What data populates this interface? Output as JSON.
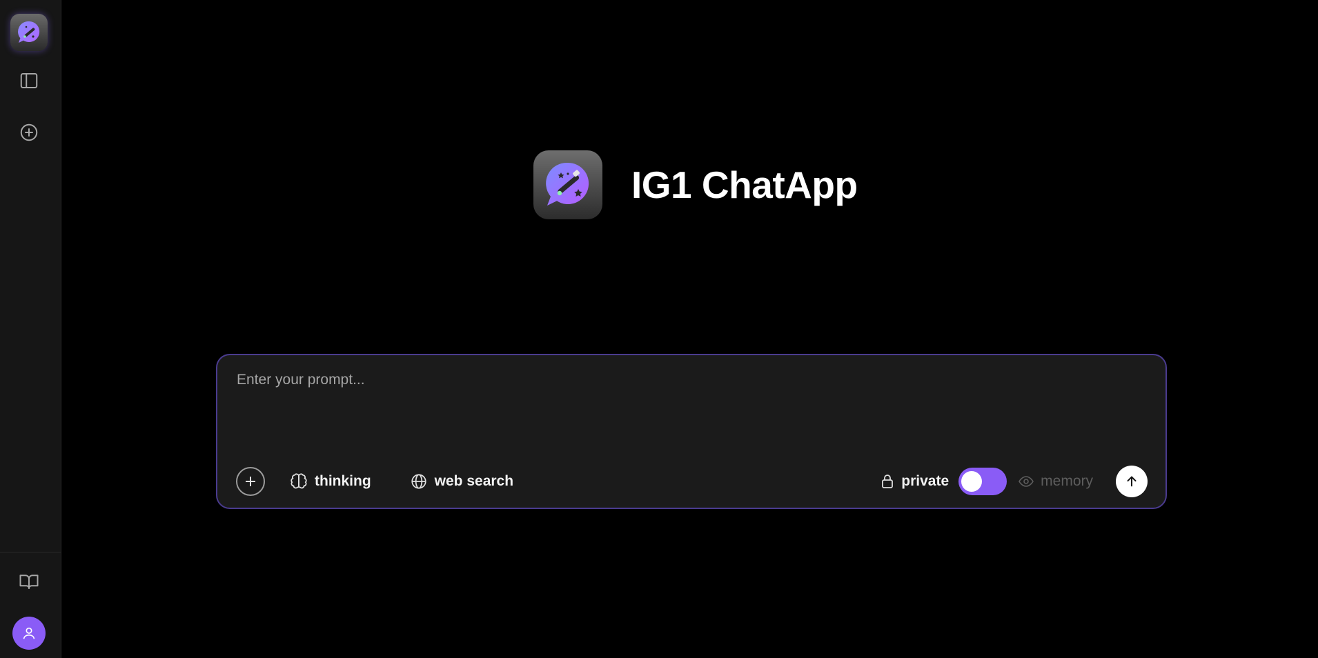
{
  "app": {
    "title": "IG1 ChatApp",
    "logo_icon": "chat-magic-wand-icon"
  },
  "sidebar": {
    "items": [
      {
        "name": "app-logo",
        "icon": "chat-magic-wand-icon"
      },
      {
        "name": "toggle-sidebar",
        "icon": "sidebar-panel-icon"
      },
      {
        "name": "new-chat",
        "icon": "plus-circle-icon"
      },
      {
        "name": "docs",
        "icon": "book-open-icon"
      },
      {
        "name": "profile",
        "icon": "user-icon"
      }
    ]
  },
  "prompt": {
    "placeholder": "Enter your prompt...",
    "value": ""
  },
  "toolbar": {
    "add_icon": "plus-icon",
    "thinking_label": "thinking",
    "thinking_icon": "brain-icon",
    "web_search_label": "web search",
    "web_search_icon": "globe-icon",
    "private_label": "private",
    "private_icon": "lock-icon",
    "private_toggle_on": true,
    "memory_label": "memory",
    "memory_icon": "eye-icon",
    "send_icon": "arrow-up-icon"
  },
  "colors": {
    "accent": "#8a5cf6",
    "prompt_border": "#4a3b8f",
    "background": "#000000",
    "sidebar": "#161616"
  }
}
